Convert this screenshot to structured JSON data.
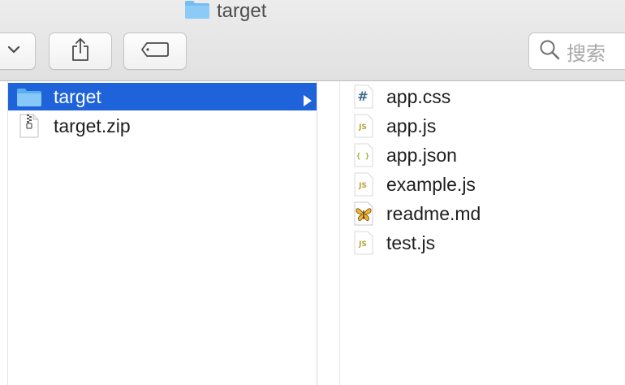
{
  "window": {
    "title": "target"
  },
  "toolbar": {
    "dropdown_icon": "chevron-down-icon",
    "share_icon": "share-icon",
    "tag_icon": "tag-icon",
    "search": {
      "placeholder": "搜索",
      "icon": "search-icon"
    }
  },
  "left_column": {
    "items": [
      {
        "label": "target",
        "icon": "folder-icon",
        "selected": true,
        "has_children": true
      },
      {
        "label": "target.zip",
        "icon": "zip-file-icon",
        "selected": false,
        "has_children": false
      }
    ]
  },
  "right_column": {
    "items": [
      {
        "label": "app.css",
        "icon": "css-file-icon"
      },
      {
        "label": "app.js",
        "icon": "js-file-icon"
      },
      {
        "label": "app.json",
        "icon": "json-file-icon"
      },
      {
        "label": "example.js",
        "icon": "js-file-icon"
      },
      {
        "label": "readme.md",
        "icon": "markdown-file-icon"
      },
      {
        "label": "test.js",
        "icon": "js-file-icon"
      }
    ]
  },
  "colors": {
    "selection": "#1f63db",
    "folder": "#6cb6f2",
    "js_icon_text": "#b8a43a",
    "css_icon_text": "#3f6f8f"
  }
}
